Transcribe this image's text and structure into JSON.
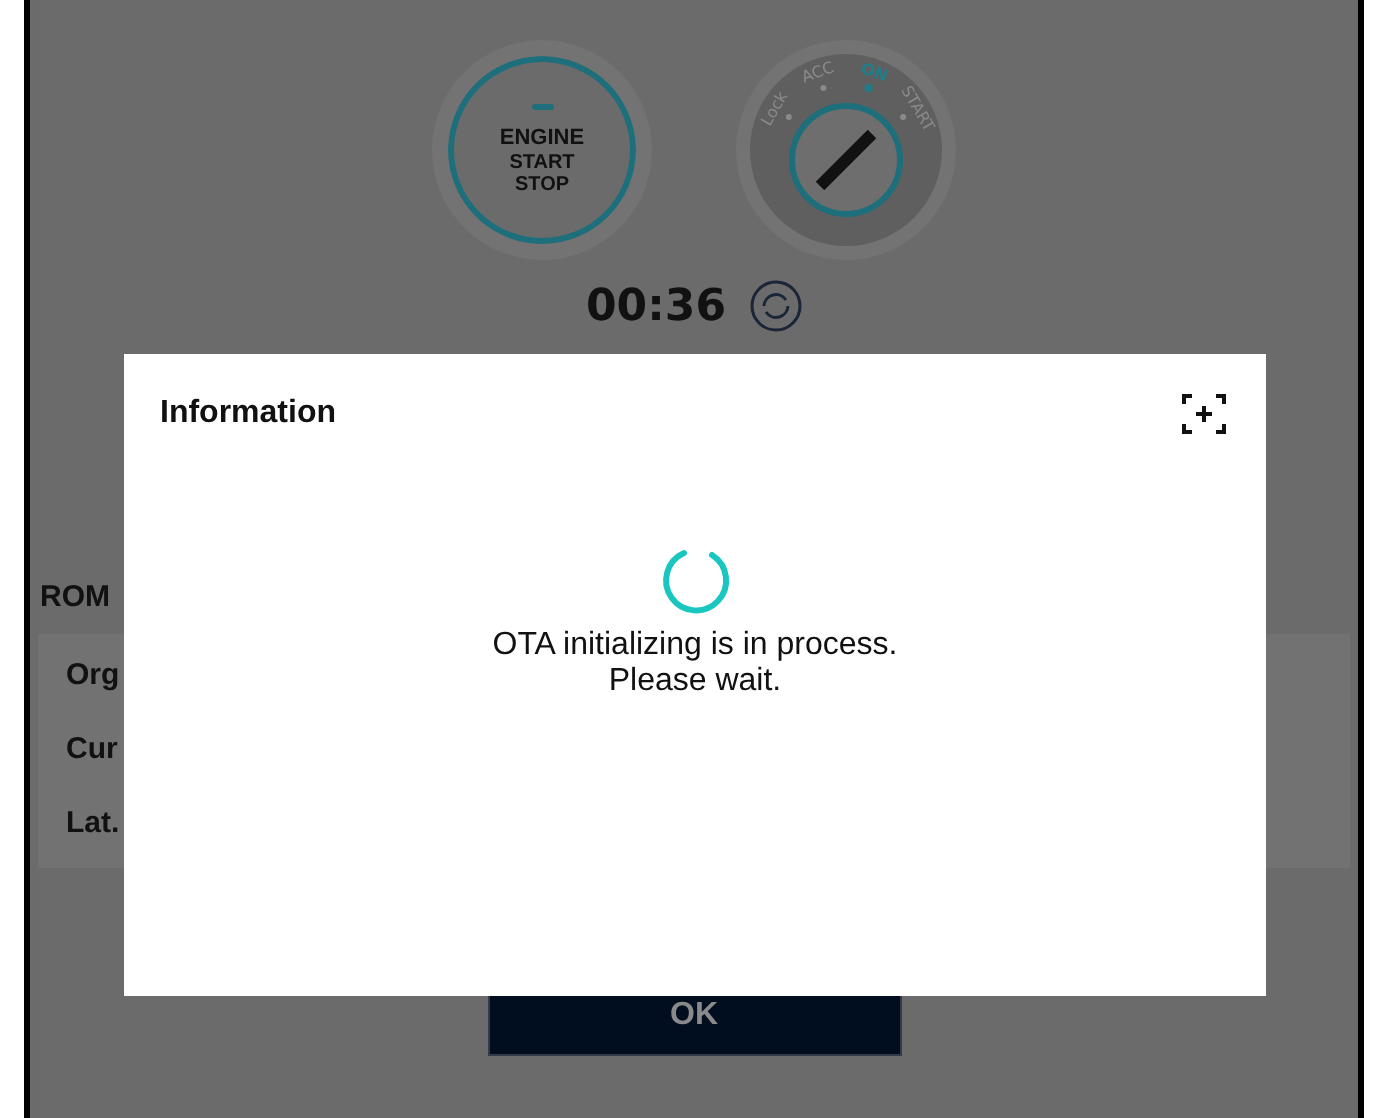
{
  "ignition": {
    "engine_button": {
      "lines": [
        "ENGINE",
        "START",
        "STOP"
      ]
    },
    "key_dial": {
      "positions": [
        {
          "label": "Lock",
          "selected": false
        },
        {
          "label": "ACC",
          "selected": false
        },
        {
          "label": "ON",
          "selected": true
        },
        {
          "label": "START",
          "selected": false
        }
      ]
    }
  },
  "timer": {
    "value": "00:36"
  },
  "rom_section": {
    "title": "ROM",
    "rows": [
      "Org",
      "Cur",
      "Lat."
    ]
  },
  "ok_button": {
    "label": "OK"
  },
  "dialog": {
    "title": "Information",
    "loading": true,
    "message_lines": [
      "OTA initializing is in process.",
      "Please wait."
    ]
  }
}
